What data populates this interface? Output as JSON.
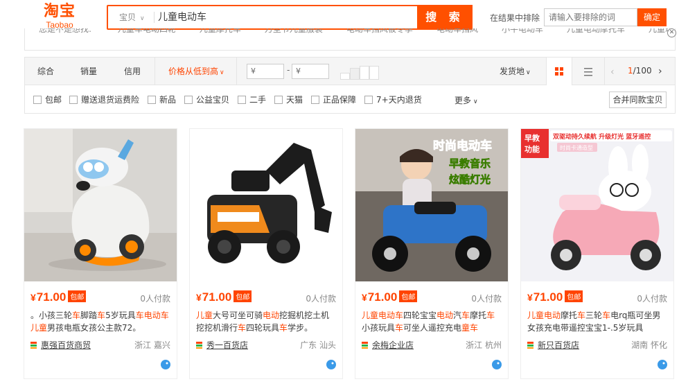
{
  "header": {
    "logo_cn": "淘宝",
    "logo_en": "Taobao",
    "search_category": "宝贝",
    "search_query": "儿童电动车",
    "search_button": "搜 索",
    "exclude_label": "在结果中排除",
    "exclude_placeholder": "请输入要排除的词",
    "exclude_button": "确定"
  },
  "suggestions": {
    "prefix": "您是不是想找:",
    "items": [
      "儿童车电动四轮",
      "儿童摩托车",
      "万圣节儿童服装",
      "电动车挡风被冬季",
      "电动车挡风",
      "小牛电动车",
      "儿童电动摩托车",
      "儿童玩具"
    ]
  },
  "sortbar": {
    "items": [
      "综合",
      "销量",
      "信用",
      "价格从低到高"
    ],
    "price_min_placeholder": "¥",
    "price_max_placeholder": "¥",
    "ship_from": "发货地",
    "page_current": "1",
    "page_total": "/100"
  },
  "filters": {
    "checkboxes": [
      "包邮",
      "赠送退货运费险",
      "新品",
      "公益宝贝",
      "二手",
      "天猫",
      "正品保障",
      "7+天内退货"
    ],
    "more": "更多",
    "merge": "合并同款宝贝"
  },
  "products": [
    {
      "price": "71.00",
      "freeship": "包邮",
      "sales": "0人付款",
      "title_parts": [
        [
          "",
          "。小孩三轮"
        ],
        [
          "hl",
          "车"
        ],
        [
          "",
          "脚踏"
        ],
        [
          "hl",
          "车"
        ],
        [
          "",
          "5岁玩具"
        ],
        [
          "hl",
          "车电动车"
        ],
        [
          "",
          "\n"
        ],
        [
          "hl",
          "儿童"
        ],
        [
          "",
          "男孩电瓶女孩公主款72。"
        ]
      ],
      "shop": "惠强百货商贸",
      "location": "浙江 嘉兴"
    },
    {
      "price": "71.00",
      "freeship": "包邮",
      "sales": "0人付款",
      "title_parts": [
        [
          "hl",
          "儿童"
        ],
        [
          "",
          "大号可坐可骑"
        ],
        [
          "hl",
          "电动"
        ],
        [
          "",
          "挖掘机挖土机"
        ],
        [
          "",
          "\n"
        ],
        [
          "",
          "挖挖机滑行"
        ],
        [
          "hl",
          "车"
        ],
        [
          "",
          "四轮玩具"
        ],
        [
          "hl",
          "车"
        ],
        [
          "",
          "学步。"
        ]
      ],
      "shop": "秀一百货店",
      "location": "广东 汕头"
    },
    {
      "price": "71.00",
      "freeship": "包邮",
      "sales": "0人付款",
      "title_parts": [
        [
          "hl",
          "儿童电动车"
        ],
        [
          "",
          "四轮宝宝"
        ],
        [
          "hl",
          "电动"
        ],
        [
          "",
          "汽"
        ],
        [
          "hl",
          "车"
        ],
        [
          "",
          "摩托"
        ],
        [
          "hl",
          "车"
        ],
        [
          "",
          "\n"
        ],
        [
          "",
          "小孩玩具"
        ],
        [
          "hl",
          "车"
        ],
        [
          "",
          "可坐人遥控充电"
        ],
        [
          "hl",
          "童车"
        ]
      ],
      "shop": "余梅企业店",
      "location": "浙江 杭州"
    },
    {
      "price": "71.00",
      "freeship": "包邮",
      "sales": "0人付款",
      "title_parts": [
        [
          "hl",
          "儿童电动"
        ],
        [
          "",
          "摩托"
        ],
        [
          "hl",
          "车"
        ],
        [
          "",
          "三轮"
        ],
        [
          "hl",
          "车"
        ],
        [
          "",
          "电rq瓶可坐男"
        ],
        [
          "",
          "\n"
        ],
        [
          "",
          "女孩充电带遥控宝宝1-.5岁玩具"
        ]
      ],
      "shop": "新只百货店",
      "location": "湖南 怀化"
    }
  ],
  "product_images": [
    {
      "kind": "white-scooter"
    },
    {
      "kind": "excavator"
    },
    {
      "kind": "atv-photo",
      "overlay_lines": [
        "时尚电动车",
        "早教音乐",
        "炫酷灯光"
      ]
    },
    {
      "kind": "pink-scooter",
      "badge_lines": [
        "早教",
        "功能"
      ],
      "banner_top": "双驱动持久续航 升级灯光 蓝牙遥控",
      "banner_sub": "时尚卡通造型"
    }
  ],
  "colors": {
    "brand": "#ff5000",
    "price": "#ff4400"
  }
}
